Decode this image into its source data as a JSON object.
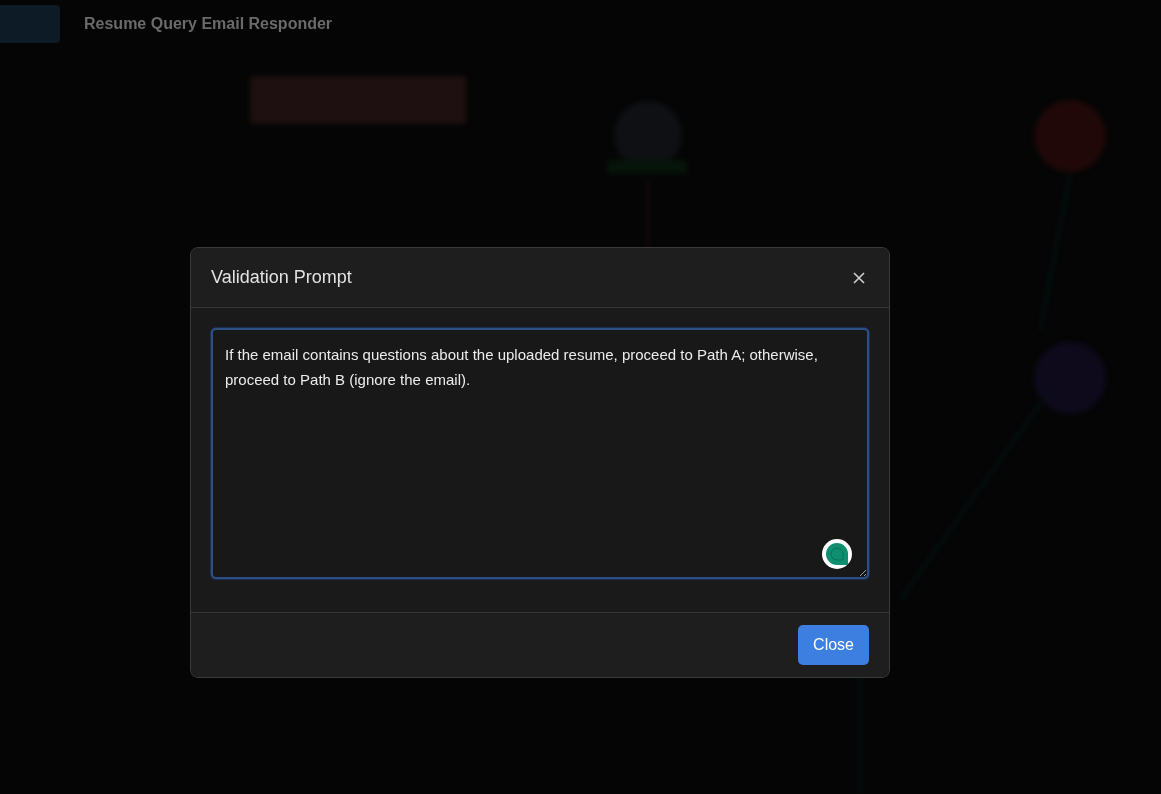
{
  "background": {
    "title": "Resume Query Email Responder"
  },
  "modal": {
    "title": "Validation Prompt",
    "prompt": "If the email contains questions about the uploaded resume, proceed to Path A; otherwise, proceed to Path B (ignore the email).",
    "focused": true,
    "buttons": [
      "Close"
    ]
  }
}
